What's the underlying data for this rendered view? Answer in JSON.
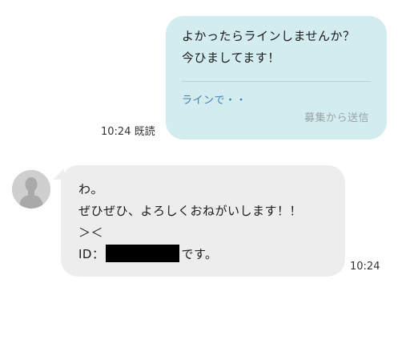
{
  "outgoing": {
    "lines": [
      "よかったらラインしませんか？",
      "今ひましてます！"
    ],
    "link_text": "ラインで・・",
    "source_label": "募集から送信",
    "time": "10:24",
    "read_status": "既読",
    "bubble_color": "#d3ecef"
  },
  "incoming": {
    "lines": [
      "わ。",
      "ぜひぜひ、よろしくおねがいします！！",
      "＞＜"
    ],
    "id_prefix": "ID：",
    "id_suffix": "です。",
    "time": "10:24",
    "bubble_color": "#ededed",
    "avatar_icon": "default-user-silhouette-icon"
  }
}
